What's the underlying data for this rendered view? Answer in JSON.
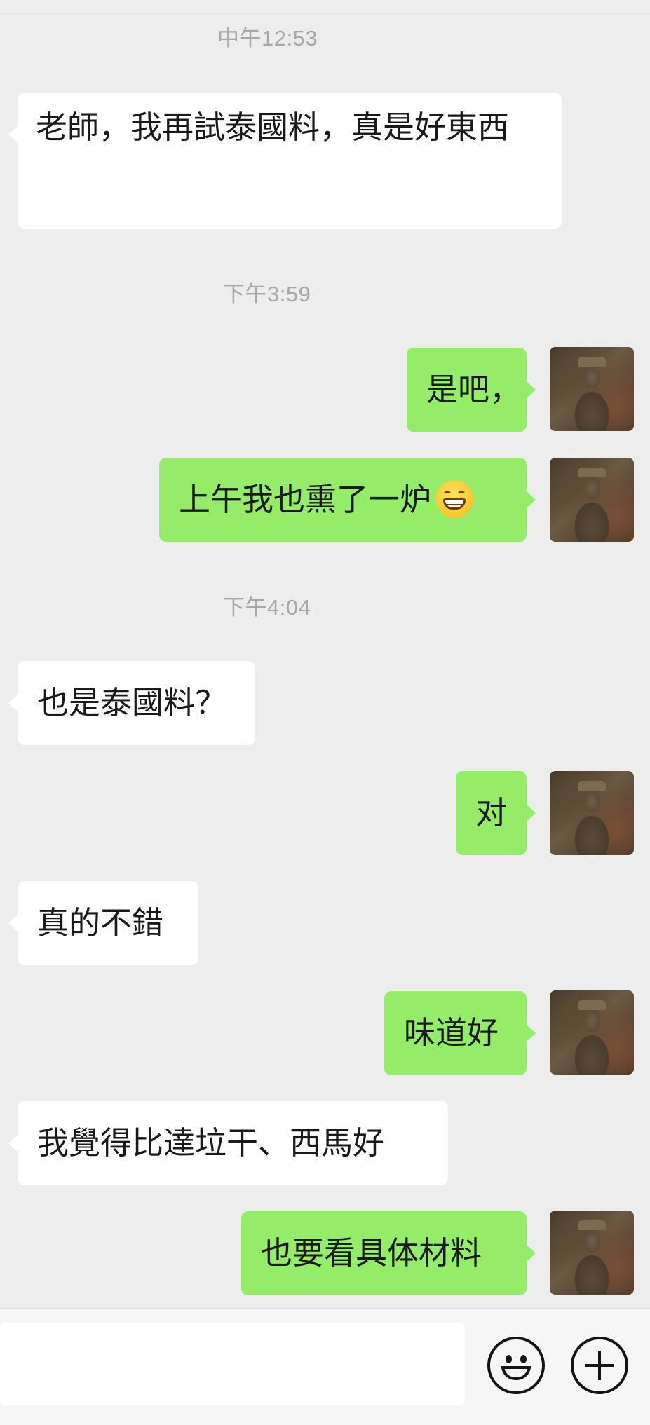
{
  "timestamps": [
    "中午12:53",
    "下午3:59",
    "下午4:04"
  ],
  "messages": [
    {
      "side": "in",
      "text": "老師，我再試泰國料，真是好東西"
    },
    {
      "side": "out",
      "text": "是吧，"
    },
    {
      "side": "out",
      "text": "上午我也熏了一炉",
      "emoji": "grinning-face-emoji"
    },
    {
      "side": "in",
      "text": "也是泰國料？"
    },
    {
      "side": "out",
      "text": "对"
    },
    {
      "side": "in",
      "text": "真的不錯"
    },
    {
      "side": "out",
      "text": "味道好"
    },
    {
      "side": "in",
      "text": "我覺得比達垃干、西馬好"
    },
    {
      "side": "out",
      "text": "也要看具体材料"
    }
  ],
  "input": {
    "value": "",
    "placeholder": ""
  },
  "icons": {
    "avatar": "buddha-statue-avatar",
    "emoji_button": "smiley-face-icon",
    "more_button": "plus-circle-icon"
  },
  "colors": {
    "outgoing_bubble": "#95ec69",
    "incoming_bubble": "#ffffff",
    "background": "#ededed"
  }
}
